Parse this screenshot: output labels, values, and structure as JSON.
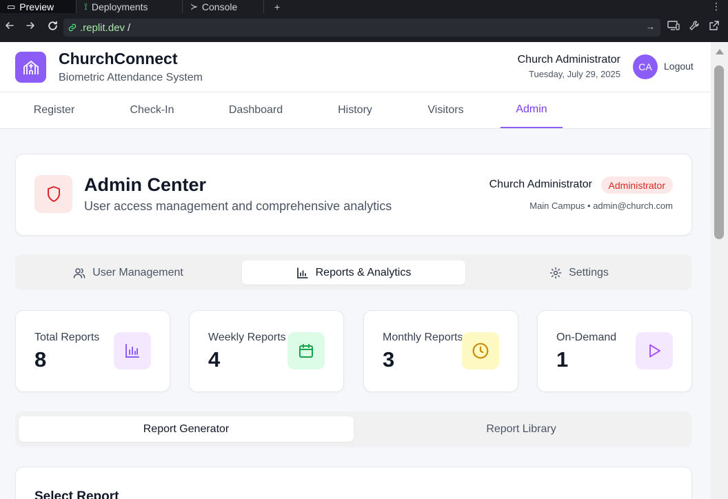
{
  "browser": {
    "tabs": [
      {
        "label": "Preview",
        "icon": "monitor-icon"
      },
      {
        "label": "Deployments",
        "icon": "deploy-icon"
      },
      {
        "label": "Console",
        "icon": "terminal-icon"
      }
    ],
    "new_tab": "+",
    "menu": "⋮",
    "url_host": ".replit.dev",
    "url_path": "/"
  },
  "app": {
    "title": "ChurchConnect",
    "subtitle": "Biometric Attendance System",
    "user_name": "Church Administrator",
    "date": "Tuesday, July 29, 2025",
    "avatar_initials": "CA",
    "logout": "Logout",
    "brand_color": "#8b5cf6"
  },
  "nav": {
    "tabs": [
      "Register",
      "Check-In",
      "Dashboard",
      "History",
      "Visitors",
      "Admin"
    ],
    "active": "Admin"
  },
  "admin": {
    "title": "Admin Center",
    "subtitle": "User access management and comprehensive analytics",
    "user": "Church Administrator",
    "role": "Administrator",
    "meta": "Main Campus • admin@church.com"
  },
  "subtabs": {
    "items": [
      "User Management",
      "Reports & Analytics",
      "Settings"
    ],
    "active": "Reports & Analytics"
  },
  "stats": [
    {
      "label": "Total Reports",
      "value": "8",
      "icon": "bar-chart-icon",
      "color": "#8b5cf6",
      "bg": "#f3e8ff"
    },
    {
      "label": "Weekly Reports",
      "value": "4",
      "icon": "calendar-icon",
      "color": "#16a34a",
      "bg": "#dcfce7"
    },
    {
      "label": "Monthly Reports",
      "value": "3",
      "icon": "clock-icon",
      "color": "#ca8a04",
      "bg": "#fef9c3"
    },
    {
      "label": "On-Demand",
      "value": "1",
      "icon": "play-icon",
      "color": "#a855f7",
      "bg": "#f3e8ff"
    }
  ],
  "report_tabs": {
    "items": [
      "Report Generator",
      "Report Library"
    ],
    "active": "Report Generator"
  },
  "select_report": {
    "title": "Select Report"
  }
}
